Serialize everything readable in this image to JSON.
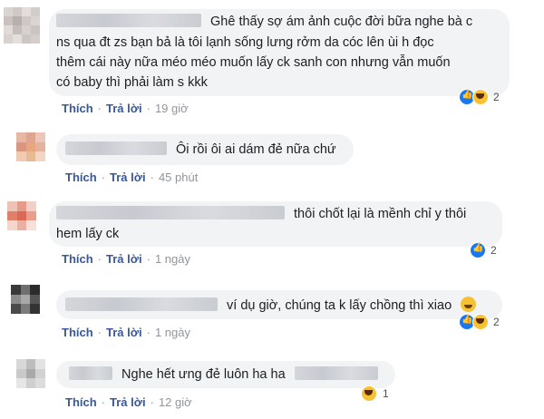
{
  "comments": [
    {
      "lines": [
        "Ghê thấy sợ ám ảnh cuộc đời bữa nghe bà c",
        "ns qua đt zs bạn bả là tôi lạnh sống lưng rởm da cóc lên ùi h đọc",
        "thêm cái này nữa méo méo muốn lấy ck sanh con nhưng vẫn muốn",
        "có baby thì phải làm s kkk"
      ],
      "like_label": "Thích",
      "reply_label": "Trả lời",
      "time": "19 giờ",
      "reaction_count": "2",
      "reaction_icons": [
        "like-icon",
        "haha-icon"
      ]
    },
    {
      "lines": [
        "Ôi rồi ôi ai dám đẻ nữa chứ"
      ],
      "like_label": "Thích",
      "reply_label": "Trả lời",
      "time": "45 phút"
    },
    {
      "lines": [
        "thôi chốt lại là mềnh chỉ y thôi",
        "hem lấy ck"
      ],
      "like_label": "Thích",
      "reply_label": "Trả lời",
      "time": "1 ngày",
      "reaction_count": "2",
      "reaction_icons": [
        "like-icon"
      ]
    },
    {
      "lines": [
        "ví dụ giờ, chúng ta k lấy chồng thì xiao"
      ],
      "like_label": "Thích",
      "reply_label": "Trả lời",
      "time": "1 ngày",
      "reaction_count": "2",
      "reaction_icons": [
        "like-icon",
        "haha-icon"
      ]
    },
    {
      "lines": [
        "Nghe hết ưng đẻ luôn ha ha"
      ],
      "like_label": "Thích",
      "reply_label": "Trả lời",
      "time": "12 giờ",
      "reaction_count": "1",
      "reaction_icons": [
        "haha-icon"
      ]
    }
  ],
  "colors": {
    "bubble": "#f2f3f5",
    "link": "#385898",
    "meta": "#90949c",
    "like": "#1877f2",
    "haha": "#f7c232"
  }
}
